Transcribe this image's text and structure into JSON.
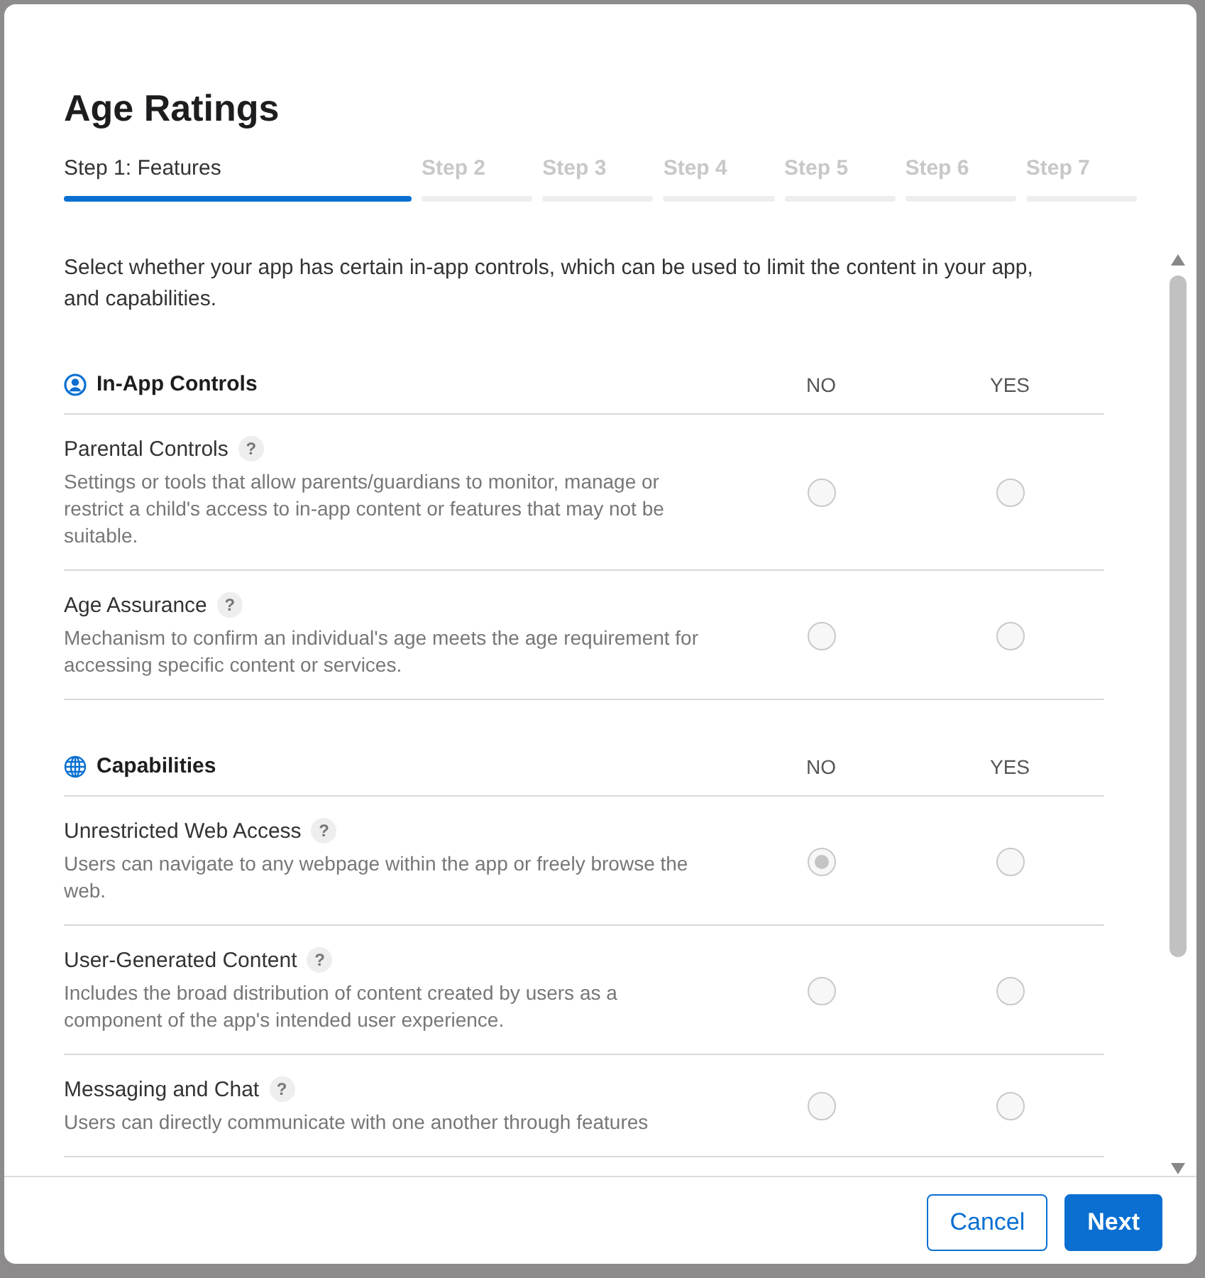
{
  "dialog": {
    "title": "Age Ratings",
    "steps": [
      {
        "label": "Step 1: Features",
        "selected": true
      },
      {
        "label": "Step 2",
        "selected": false
      },
      {
        "label": "Step 3",
        "selected": false
      },
      {
        "label": "Step 4",
        "selected": false
      },
      {
        "label": "Step 5",
        "selected": false
      },
      {
        "label": "Step 6",
        "selected": false
      },
      {
        "label": "Step 7",
        "selected": false
      }
    ],
    "intro": "Select whether your app has certain in-app controls, which can be used to limit the content in your app, and capabilities.",
    "sections": [
      {
        "title": "In-App Controls",
        "columns": [
          "NO",
          "YES"
        ],
        "items": [
          {
            "label": "Parental Controls",
            "help": "?",
            "description": "Settings or tools that allow parents/guardians to monitor, manage or restrict a child's access to in-app content or features that may not be suitable.",
            "options": [
              {
                "selected": false
              },
              {
                "selected": false
              }
            ]
          },
          {
            "label": "Age Assurance",
            "help": "?",
            "description": "Mechanism to confirm an individual's age meets the age requirement for accessing specific content or services.",
            "options": [
              {
                "selected": false
              },
              {
                "selected": false
              }
            ]
          }
        ]
      },
      {
        "title": "Capabilities",
        "columns": [
          "NO",
          "YES"
        ],
        "items": [
          {
            "label": "Unrestricted Web Access",
            "help": "?",
            "description": "Users can navigate to any webpage within the app or freely browse the web.",
            "options": [
              {
                "selected": true
              },
              {
                "selected": false
              }
            ]
          },
          {
            "label": "User-Generated Content",
            "help": "?",
            "description": "Includes the broad distribution of content created by users as a component of the app's intended user experience.",
            "options": [
              {
                "selected": false
              },
              {
                "selected": false
              }
            ]
          },
          {
            "label": "Messaging and Chat",
            "help": "?",
            "description": "Users can directly communicate with one another through features",
            "options": [
              {
                "selected": false
              },
              {
                "selected": false
              }
            ]
          }
        ]
      }
    ],
    "buttons": [
      {
        "label": "Cancel",
        "kind": "secondary"
      },
      {
        "label": "Next",
        "kind": "primary"
      }
    ]
  }
}
